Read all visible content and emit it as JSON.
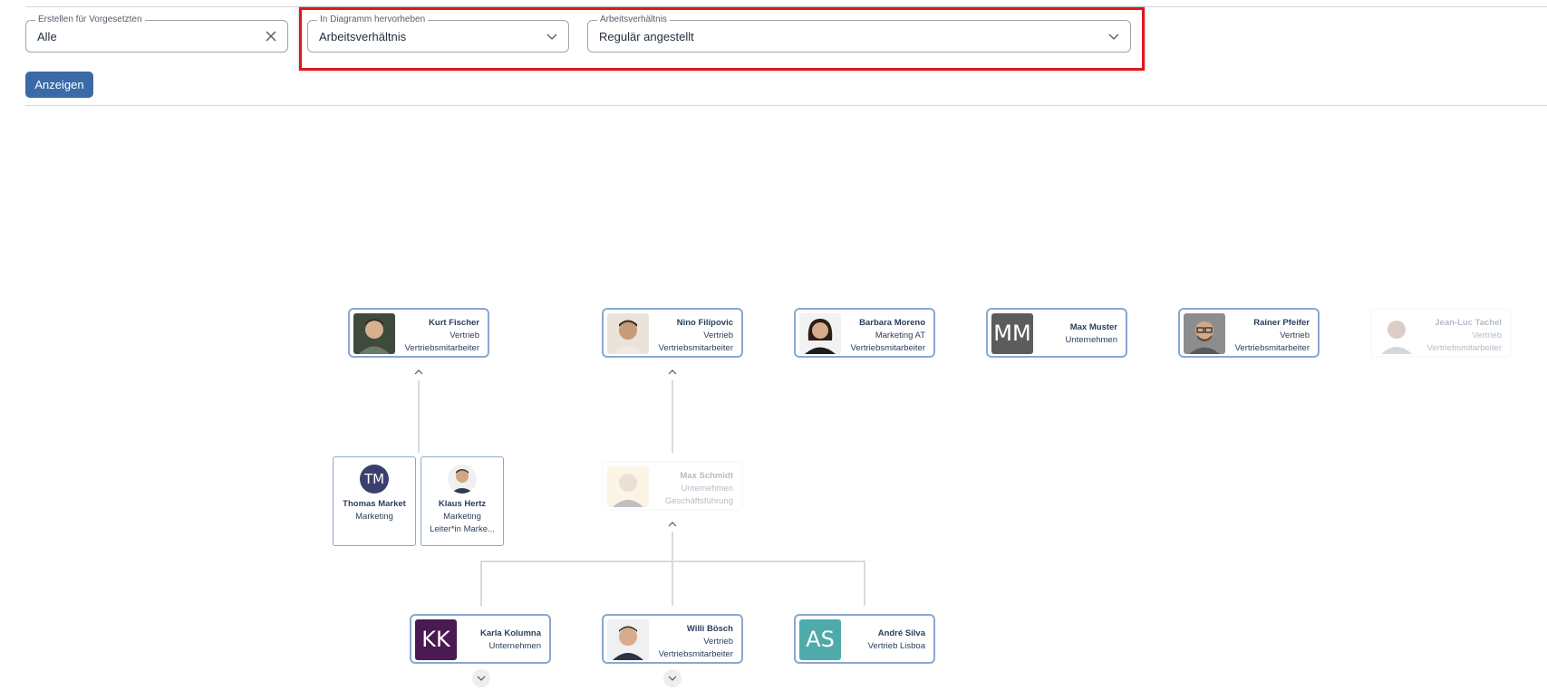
{
  "filters": {
    "supervisor": {
      "label": "Erstellen für Vorgesetzten",
      "value": "Alle"
    },
    "highlight": {
      "label": "In Diagramm hervorheben",
      "value": "Arbeitsverhältnis"
    },
    "employment": {
      "label": "Arbeitsverhältnis",
      "value": "Regulär angestellt"
    }
  },
  "show_button": "Anzeigen",
  "top_row": [
    {
      "name": "Kurt Fischer",
      "dept": "Vertrieb",
      "role": "Vertriebsmitarbeiter"
    },
    {
      "name": "Nino Filipovic",
      "dept": "Vertrieb",
      "role": "Vertriebsmitarbeiter"
    },
    {
      "name": "Barbara Moreno",
      "dept": "Marketing AT",
      "role": "Vertriebsmitarbeiter"
    },
    {
      "name": "Max Muster",
      "dept": "Unternehmen",
      "initials": "MM",
      "color": "#5c5c5c"
    },
    {
      "name": "Rainer Pfeifer",
      "dept": "Vertrieb",
      "role": "Vertriebsmitarbeiter"
    },
    {
      "name": "Jean-Luc Tachel",
      "dept": "Vertrieb",
      "role": "Vertriebsmitarbeiter"
    }
  ],
  "kurt_reports": [
    {
      "name": "Thomas Market",
      "dept": "Marketing",
      "initials": "TM",
      "color": "#3b3f6f"
    },
    {
      "name": "Klaus Hertz",
      "dept": "Marketing",
      "role": "Leiter*in Marke..."
    }
  ],
  "max_schmidt": {
    "name": "Max Schmidt",
    "dept": "Unternehmen",
    "role": "Geschäftsführung"
  },
  "bottom_row": [
    {
      "name": "Karla Kolumna",
      "dept": "Unternehmen",
      "initials": "KK",
      "color": "#4a1a52"
    },
    {
      "name": "Willi Bösch",
      "dept": "Vertrieb",
      "role": "Vertriebsmitarbeiter"
    },
    {
      "name": "André Silva",
      "dept": "Vertrieb Lisboa",
      "initials": "AS",
      "color": "#4faaaa"
    }
  ]
}
